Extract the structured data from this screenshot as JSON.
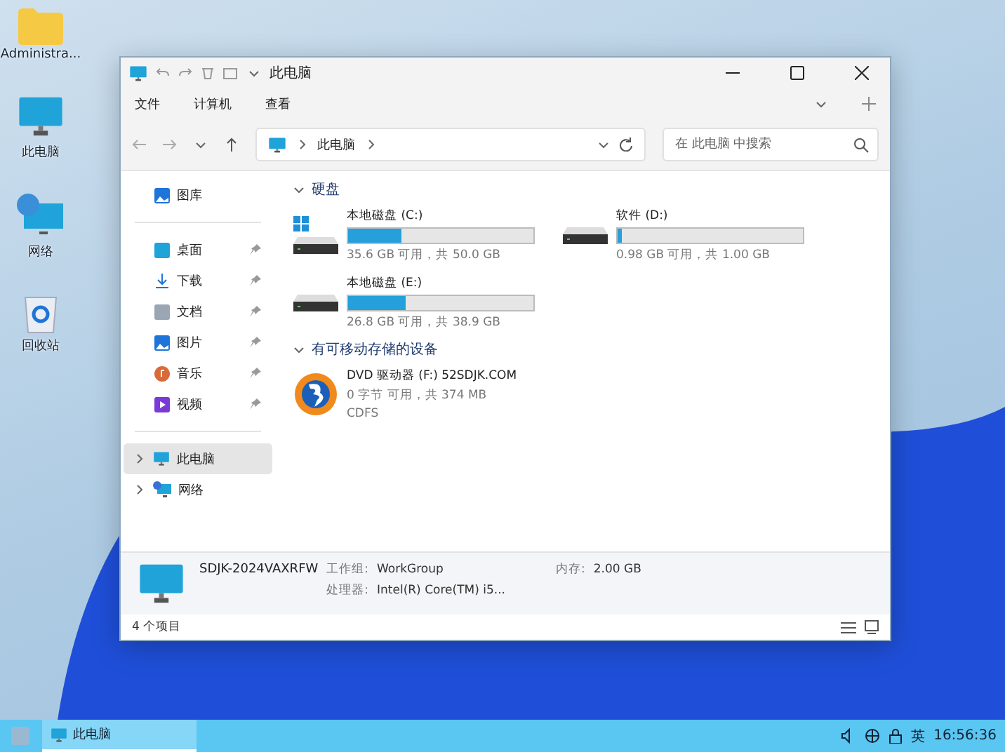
{
  "desktop_icons": [
    {
      "label": "Administra...",
      "kind": "folder"
    },
    {
      "label": "此电脑",
      "kind": "pc"
    },
    {
      "label": "网络",
      "kind": "network"
    },
    {
      "label": "回收站",
      "kind": "bin"
    }
  ],
  "window": {
    "title": "此电脑",
    "menu": [
      "文件",
      "计算机",
      "查看"
    ],
    "address": {
      "crumb": "此电脑"
    },
    "search": {
      "placeholder": "在 此电脑 中搜索"
    }
  },
  "sidebar": {
    "top": [
      {
        "label": "图库",
        "kind": "gallery",
        "pinned": false,
        "selected": false
      }
    ],
    "quick": [
      {
        "label": "桌面",
        "kind": "desktop",
        "pinned": true,
        "selected": false
      },
      {
        "label": "下载",
        "kind": "download",
        "pinned": true,
        "selected": false
      },
      {
        "label": "文档",
        "kind": "docs",
        "pinned": true,
        "selected": false
      },
      {
        "label": "图片",
        "kind": "gallery",
        "pinned": true,
        "selected": false
      },
      {
        "label": "音乐",
        "kind": "music",
        "pinned": true,
        "selected": false
      },
      {
        "label": "视频",
        "kind": "video",
        "pinned": true,
        "selected": false
      }
    ],
    "tree": [
      {
        "label": "此电脑",
        "kind": "pc",
        "selected": true
      },
      {
        "label": "网络",
        "kind": "network",
        "selected": false
      }
    ]
  },
  "groups": [
    {
      "title": "硬盘",
      "expanded": true,
      "items": [
        {
          "name": "本地磁盘 (C:)",
          "kind": "system",
          "level": 0.288,
          "info": "35.6 GB 可用，共 50.0 GB"
        },
        {
          "name": "软件 (D:)",
          "kind": "disk",
          "level": 0.02,
          "info": "0.98 GB 可用，共 1.00 GB"
        },
        {
          "name": "本地磁盘 (E:)",
          "kind": "disk",
          "level": 0.311,
          "info": "26.8 GB 可用，共 38.9 GB"
        }
      ]
    },
    {
      "title": "有可移动存储的设备",
      "expanded": true,
      "items": [
        {
          "name": "DVD 驱动器 (F:) 52SDJK.COM",
          "kind": "dvd",
          "info": "0 字节 可用，共 374 MB",
          "extra": "CDFS"
        }
      ]
    }
  ],
  "details": {
    "name": "SDJK-2024VAXRFW",
    "fields": [
      {
        "label": "工作组:",
        "value": "WorkGroup"
      },
      {
        "label": "内存:",
        "value": "2.00 GB"
      },
      {
        "label": "处理器:",
        "value": "Intel(R) Core(TM) i5..."
      }
    ]
  },
  "status_bar": {
    "count": "4 个项目"
  },
  "taskbar": {
    "apps": [
      {
        "label": "此电脑",
        "selected": true
      }
    ],
    "ime": "英",
    "time": "16:56:36"
  }
}
